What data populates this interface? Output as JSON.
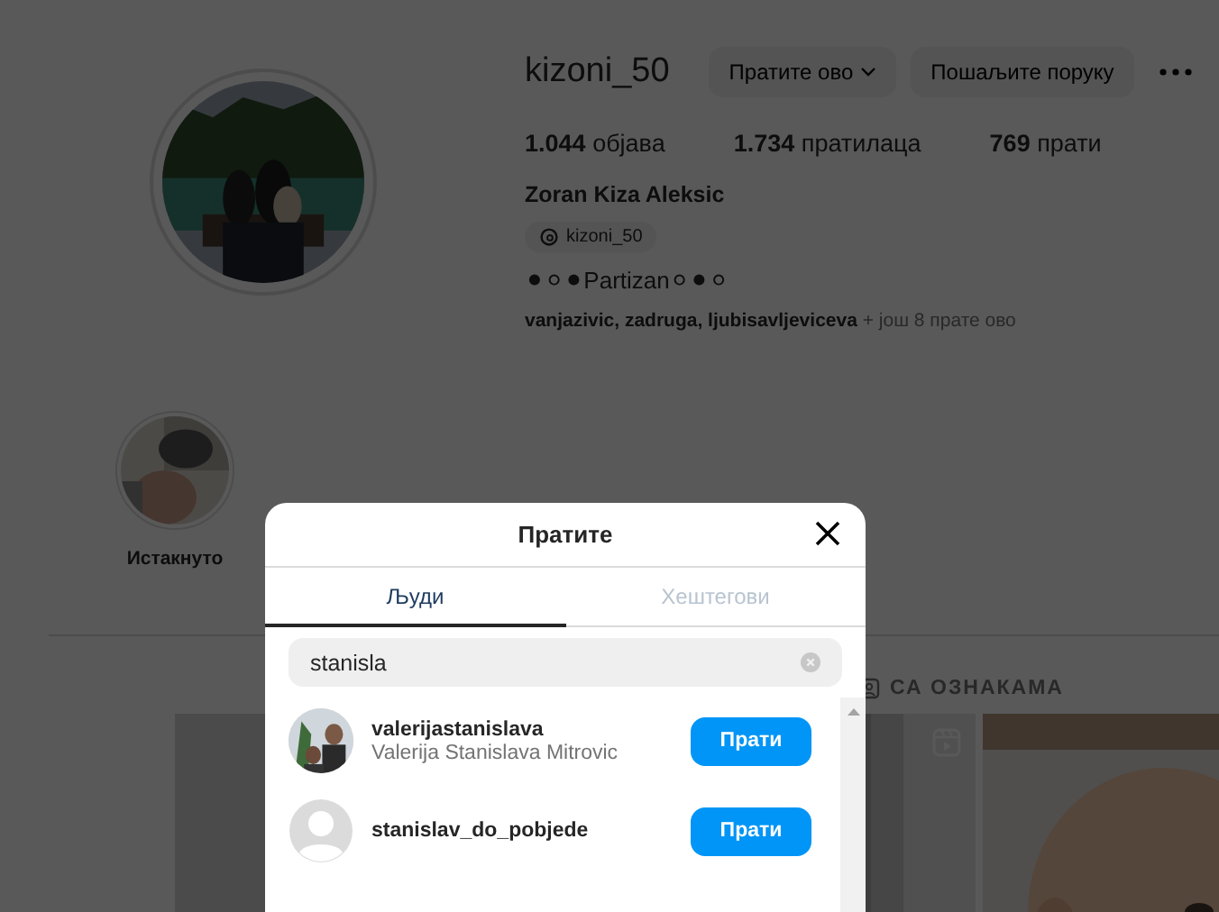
{
  "profile": {
    "username": "kizoni_50",
    "follow_button": "Пратите ово",
    "message_button": "Пошаљите поруку",
    "stats": [
      {
        "value": "1.044",
        "label": "објава"
      },
      {
        "value": "1.734",
        "label": "пратилаца"
      },
      {
        "value": "769",
        "label": "прати"
      }
    ],
    "full_name": "Zoran Kiza Aleksic",
    "threads_handle": "kizoni_50",
    "bio": "⚫⚪⚫Partizan⚪⚫⚪",
    "followed_by": {
      "names": "vanjazivic, zadruga, ljubisavljeviceva",
      "more": "+ још 8 прате ово"
    }
  },
  "highlights": [
    {
      "label": "Истакнуто"
    }
  ],
  "profile_tabs": [
    {
      "label": "СА ОЗНАКАМА"
    }
  ],
  "posts": [
    {
      "kind": "picture"
    },
    {
      "kind": "reel"
    },
    {
      "kind": "picture"
    }
  ],
  "modal": {
    "title": "Пратите",
    "tabs": [
      {
        "label": "Људи",
        "selected": true
      },
      {
        "label": "Хештегови",
        "selected": false
      }
    ],
    "search": {
      "value": "stanisla"
    },
    "results": [
      {
        "username": "valerijastanislava",
        "full_name": "Valerija Stanislava Mitrovic",
        "has_photo": true,
        "button": "Прати"
      },
      {
        "username": "stanislav_do_pobjede",
        "has_photo": false,
        "button": "Прати"
      }
    ]
  }
}
